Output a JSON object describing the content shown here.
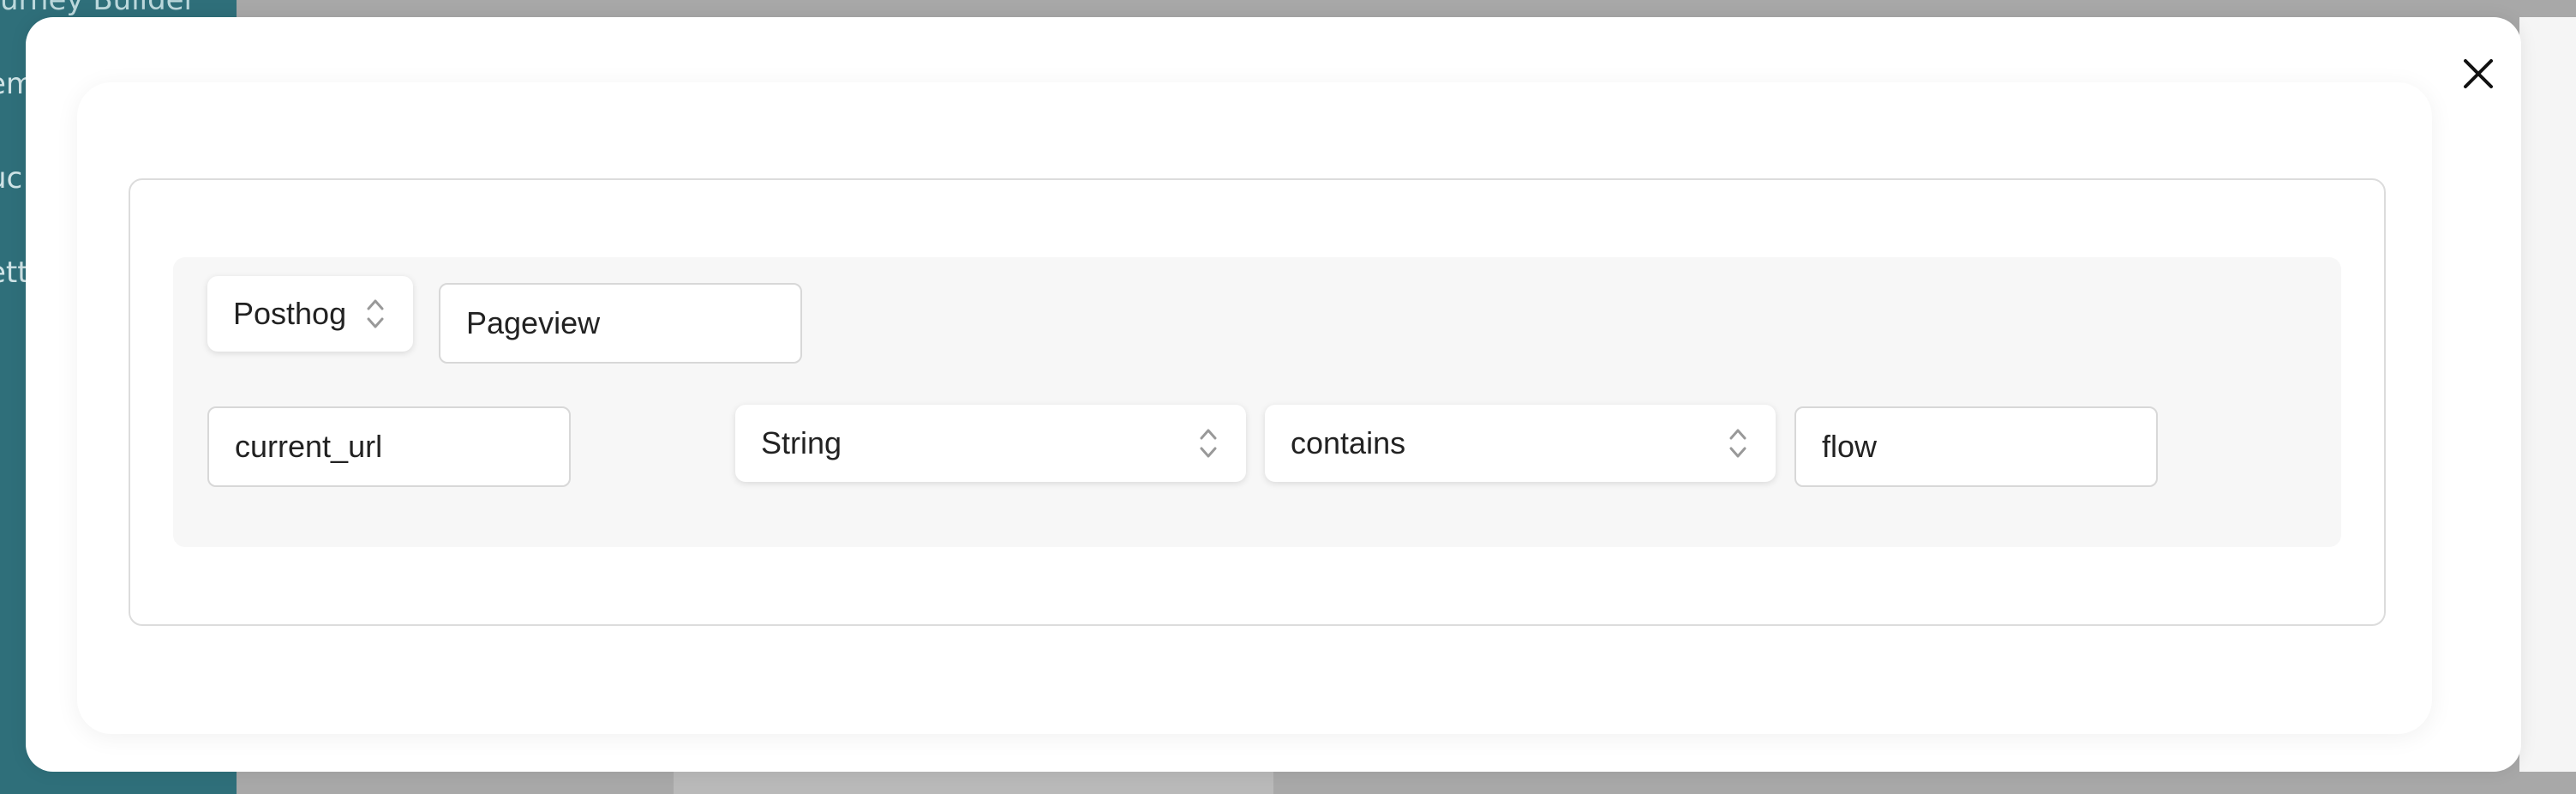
{
  "background": {
    "sidebar_title_fragment": "urney Builder",
    "sidebar_items": [
      "em",
      "uc",
      "ett"
    ]
  },
  "modal": {
    "close_icon": "close-icon",
    "rule": {
      "provider": {
        "value": "Posthog",
        "icon": "chevron-updown-icon"
      },
      "event_name": {
        "value": "Pageview"
      },
      "property": {
        "value": "current_url"
      },
      "type": {
        "value": "String",
        "icon": "chevron-updown-icon"
      },
      "operator": {
        "value": "contains",
        "icon": "chevron-updown-icon"
      },
      "comparison_value": {
        "value": "flow"
      }
    }
  },
  "colors": {
    "sidebar": "#2f6f7a",
    "overlay": "#a8a8a8",
    "panel_border": "#dcdcdc",
    "row_bg": "#f7f7f7"
  }
}
